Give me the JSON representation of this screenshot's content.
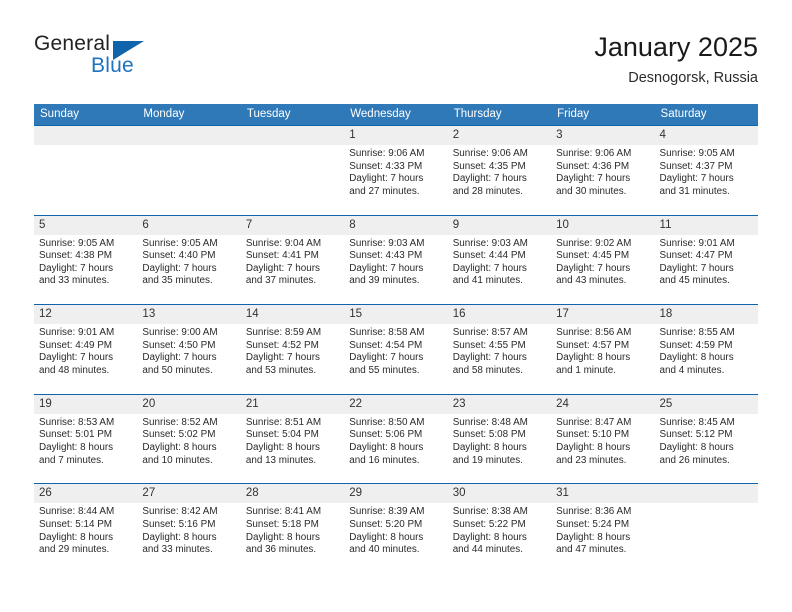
{
  "brand": {
    "name_part1": "General",
    "name_part2": "Blue",
    "flag_icon": "triangle-flag-icon",
    "accent_color": "#1064ac"
  },
  "header": {
    "title": "January 2025",
    "subtitle": "Desnogorsk, Russia"
  },
  "calendar": {
    "header_bg": "#3079b8",
    "row_divider_color": "#1064ac",
    "day_band_bg": "#efefef",
    "weekdays": [
      "Sunday",
      "Monday",
      "Tuesday",
      "Wednesday",
      "Thursday",
      "Friday",
      "Saturday"
    ],
    "weeks": [
      [
        {
          "day": "",
          "sunrise": "",
          "sunset": "",
          "daylight_line1": "",
          "daylight_line2": ""
        },
        {
          "day": "",
          "sunrise": "",
          "sunset": "",
          "daylight_line1": "",
          "daylight_line2": ""
        },
        {
          "day": "",
          "sunrise": "",
          "sunset": "",
          "daylight_line1": "",
          "daylight_line2": ""
        },
        {
          "day": "1",
          "sunrise": "Sunrise: 9:06 AM",
          "sunset": "Sunset: 4:33 PM",
          "daylight_line1": "Daylight: 7 hours",
          "daylight_line2": "and 27 minutes."
        },
        {
          "day": "2",
          "sunrise": "Sunrise: 9:06 AM",
          "sunset": "Sunset: 4:35 PM",
          "daylight_line1": "Daylight: 7 hours",
          "daylight_line2": "and 28 minutes."
        },
        {
          "day": "3",
          "sunrise": "Sunrise: 9:06 AM",
          "sunset": "Sunset: 4:36 PM",
          "daylight_line1": "Daylight: 7 hours",
          "daylight_line2": "and 30 minutes."
        },
        {
          "day": "4",
          "sunrise": "Sunrise: 9:05 AM",
          "sunset": "Sunset: 4:37 PM",
          "daylight_line1": "Daylight: 7 hours",
          "daylight_line2": "and 31 minutes."
        }
      ],
      [
        {
          "day": "5",
          "sunrise": "Sunrise: 9:05 AM",
          "sunset": "Sunset: 4:38 PM",
          "daylight_line1": "Daylight: 7 hours",
          "daylight_line2": "and 33 minutes."
        },
        {
          "day": "6",
          "sunrise": "Sunrise: 9:05 AM",
          "sunset": "Sunset: 4:40 PM",
          "daylight_line1": "Daylight: 7 hours",
          "daylight_line2": "and 35 minutes."
        },
        {
          "day": "7",
          "sunrise": "Sunrise: 9:04 AM",
          "sunset": "Sunset: 4:41 PM",
          "daylight_line1": "Daylight: 7 hours",
          "daylight_line2": "and 37 minutes."
        },
        {
          "day": "8",
          "sunrise": "Sunrise: 9:03 AM",
          "sunset": "Sunset: 4:43 PM",
          "daylight_line1": "Daylight: 7 hours",
          "daylight_line2": "and 39 minutes."
        },
        {
          "day": "9",
          "sunrise": "Sunrise: 9:03 AM",
          "sunset": "Sunset: 4:44 PM",
          "daylight_line1": "Daylight: 7 hours",
          "daylight_line2": "and 41 minutes."
        },
        {
          "day": "10",
          "sunrise": "Sunrise: 9:02 AM",
          "sunset": "Sunset: 4:45 PM",
          "daylight_line1": "Daylight: 7 hours",
          "daylight_line2": "and 43 minutes."
        },
        {
          "day": "11",
          "sunrise": "Sunrise: 9:01 AM",
          "sunset": "Sunset: 4:47 PM",
          "daylight_line1": "Daylight: 7 hours",
          "daylight_line2": "and 45 minutes."
        }
      ],
      [
        {
          "day": "12",
          "sunrise": "Sunrise: 9:01 AM",
          "sunset": "Sunset: 4:49 PM",
          "daylight_line1": "Daylight: 7 hours",
          "daylight_line2": "and 48 minutes."
        },
        {
          "day": "13",
          "sunrise": "Sunrise: 9:00 AM",
          "sunset": "Sunset: 4:50 PM",
          "daylight_line1": "Daylight: 7 hours",
          "daylight_line2": "and 50 minutes."
        },
        {
          "day": "14",
          "sunrise": "Sunrise: 8:59 AM",
          "sunset": "Sunset: 4:52 PM",
          "daylight_line1": "Daylight: 7 hours",
          "daylight_line2": "and 53 minutes."
        },
        {
          "day": "15",
          "sunrise": "Sunrise: 8:58 AM",
          "sunset": "Sunset: 4:54 PM",
          "daylight_line1": "Daylight: 7 hours",
          "daylight_line2": "and 55 minutes."
        },
        {
          "day": "16",
          "sunrise": "Sunrise: 8:57 AM",
          "sunset": "Sunset: 4:55 PM",
          "daylight_line1": "Daylight: 7 hours",
          "daylight_line2": "and 58 minutes."
        },
        {
          "day": "17",
          "sunrise": "Sunrise: 8:56 AM",
          "sunset": "Sunset: 4:57 PM",
          "daylight_line1": "Daylight: 8 hours",
          "daylight_line2": "and 1 minute."
        },
        {
          "day": "18",
          "sunrise": "Sunrise: 8:55 AM",
          "sunset": "Sunset: 4:59 PM",
          "daylight_line1": "Daylight: 8 hours",
          "daylight_line2": "and 4 minutes."
        }
      ],
      [
        {
          "day": "19",
          "sunrise": "Sunrise: 8:53 AM",
          "sunset": "Sunset: 5:01 PM",
          "daylight_line1": "Daylight: 8 hours",
          "daylight_line2": "and 7 minutes."
        },
        {
          "day": "20",
          "sunrise": "Sunrise: 8:52 AM",
          "sunset": "Sunset: 5:02 PM",
          "daylight_line1": "Daylight: 8 hours",
          "daylight_line2": "and 10 minutes."
        },
        {
          "day": "21",
          "sunrise": "Sunrise: 8:51 AM",
          "sunset": "Sunset: 5:04 PM",
          "daylight_line1": "Daylight: 8 hours",
          "daylight_line2": "and 13 minutes."
        },
        {
          "day": "22",
          "sunrise": "Sunrise: 8:50 AM",
          "sunset": "Sunset: 5:06 PM",
          "daylight_line1": "Daylight: 8 hours",
          "daylight_line2": "and 16 minutes."
        },
        {
          "day": "23",
          "sunrise": "Sunrise: 8:48 AM",
          "sunset": "Sunset: 5:08 PM",
          "daylight_line1": "Daylight: 8 hours",
          "daylight_line2": "and 19 minutes."
        },
        {
          "day": "24",
          "sunrise": "Sunrise: 8:47 AM",
          "sunset": "Sunset: 5:10 PM",
          "daylight_line1": "Daylight: 8 hours",
          "daylight_line2": "and 23 minutes."
        },
        {
          "day": "25",
          "sunrise": "Sunrise: 8:45 AM",
          "sunset": "Sunset: 5:12 PM",
          "daylight_line1": "Daylight: 8 hours",
          "daylight_line2": "and 26 minutes."
        }
      ],
      [
        {
          "day": "26",
          "sunrise": "Sunrise: 8:44 AM",
          "sunset": "Sunset: 5:14 PM",
          "daylight_line1": "Daylight: 8 hours",
          "daylight_line2": "and 29 minutes."
        },
        {
          "day": "27",
          "sunrise": "Sunrise: 8:42 AM",
          "sunset": "Sunset: 5:16 PM",
          "daylight_line1": "Daylight: 8 hours",
          "daylight_line2": "and 33 minutes."
        },
        {
          "day": "28",
          "sunrise": "Sunrise: 8:41 AM",
          "sunset": "Sunset: 5:18 PM",
          "daylight_line1": "Daylight: 8 hours",
          "daylight_line2": "and 36 minutes."
        },
        {
          "day": "29",
          "sunrise": "Sunrise: 8:39 AM",
          "sunset": "Sunset: 5:20 PM",
          "daylight_line1": "Daylight: 8 hours",
          "daylight_line2": "and 40 minutes."
        },
        {
          "day": "30",
          "sunrise": "Sunrise: 8:38 AM",
          "sunset": "Sunset: 5:22 PM",
          "daylight_line1": "Daylight: 8 hours",
          "daylight_line2": "and 44 minutes."
        },
        {
          "day": "31",
          "sunrise": "Sunrise: 8:36 AM",
          "sunset": "Sunset: 5:24 PM",
          "daylight_line1": "Daylight: 8 hours",
          "daylight_line2": "and 47 minutes."
        },
        {
          "day": "",
          "sunrise": "",
          "sunset": "",
          "daylight_line1": "",
          "daylight_line2": ""
        }
      ]
    ]
  }
}
